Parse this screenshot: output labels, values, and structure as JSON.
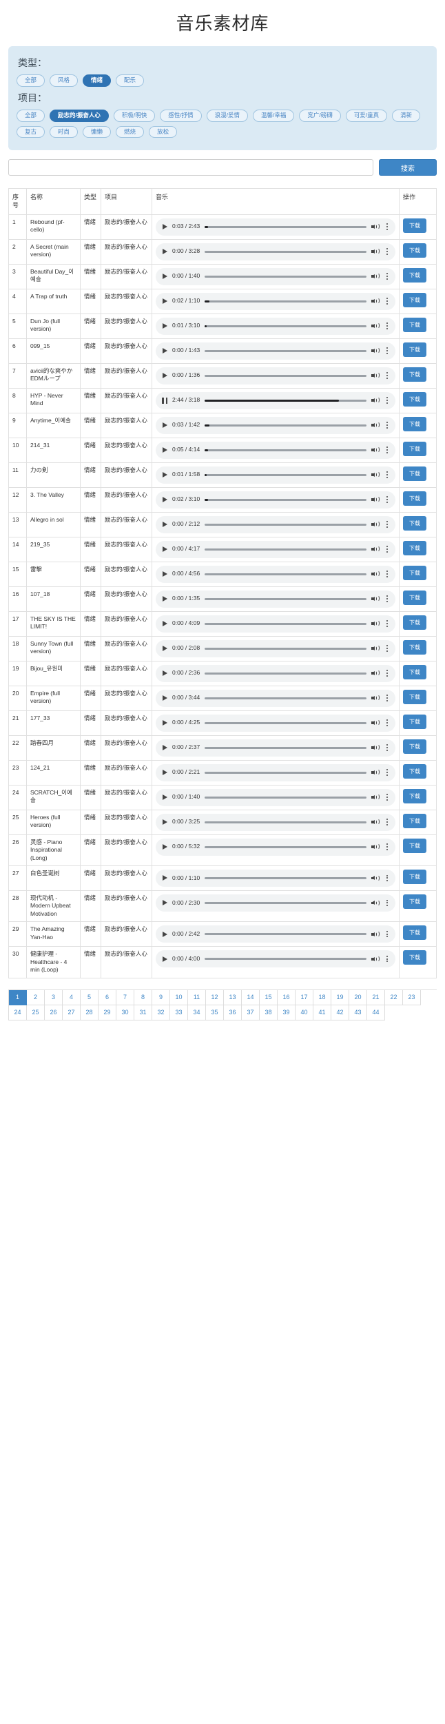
{
  "header": {
    "title": "音乐素材库"
  },
  "filters": {
    "type": {
      "label": "类型：",
      "options": [
        "全部",
        "风格",
        "情绪",
        "配乐"
      ],
      "selected": "情绪"
    },
    "project": {
      "label": "项目：",
      "options": [
        "全部",
        "励志的/振奋人心",
        "积极/明快",
        "感性/抒情",
        "浪漫/爱情",
        "温馨/幸福",
        "宽广/磅礴",
        "可爱/童真",
        "清新",
        "复古",
        "时尚",
        "慵懒",
        "燃烧",
        "放松"
      ],
      "selected": "励志的/振奋人心"
    }
  },
  "search": {
    "value": "",
    "placeholder": "",
    "button_label": "搜索"
  },
  "table": {
    "columns": [
      "序号",
      "名称",
      "类型",
      "项目",
      "音乐",
      "操作"
    ],
    "download_label": "下载",
    "rows": [
      {
        "index": "1",
        "name": "Rebound (pf-cello)",
        "type": "情绪",
        "project": "励志的/振奋人心",
        "time": "0:03 / 2:43",
        "progress": 2,
        "playing": false
      },
      {
        "index": "2",
        "name": "A Secret (main version)",
        "type": "情绪",
        "project": "励志的/振奋人心",
        "time": "0:00 / 3:28",
        "progress": 0,
        "playing": false
      },
      {
        "index": "3",
        "name": "Beautiful Day_이예슬",
        "type": "情绪",
        "project": "励志的/振奋人心",
        "time": "0:00 / 1:40",
        "progress": 0,
        "playing": false
      },
      {
        "index": "4",
        "name": "A Trap of truth",
        "type": "情绪",
        "project": "励志的/振奋人心",
        "time": "0:02 / 1:10",
        "progress": 3,
        "playing": false
      },
      {
        "index": "5",
        "name": "Dun Jo (full version)",
        "type": "情绪",
        "project": "励志的/振奋人心",
        "time": "0:01 / 3:10",
        "progress": 1,
        "playing": false
      },
      {
        "index": "6",
        "name": "099_15",
        "type": "情绪",
        "project": "励志的/振奋人心",
        "time": "0:00 / 1:43",
        "progress": 0,
        "playing": false
      },
      {
        "index": "7",
        "name": "avicii的な爽やかEDMループ",
        "type": "情绪",
        "project": "励志的/振奋人心",
        "time": "0:00 / 1:36",
        "progress": 0,
        "playing": false
      },
      {
        "index": "8",
        "name": "HYP - Never Mind",
        "type": "情绪",
        "project": "励志的/振奋人心",
        "time": "2:44 / 3:18",
        "progress": 83,
        "playing": true
      },
      {
        "index": "9",
        "name": "Anytime_이예솔",
        "type": "情绪",
        "project": "励志的/振奋人心",
        "time": "0:03 / 1:42",
        "progress": 3,
        "playing": false
      },
      {
        "index": "10",
        "name": "214_31",
        "type": "情绪",
        "project": "励志的/振奋人心",
        "time": "0:05 / 4:14",
        "progress": 2,
        "playing": false
      },
      {
        "index": "11",
        "name": "力の剣",
        "type": "情绪",
        "project": "励志的/振奋人心",
        "time": "0:01 / 1:58",
        "progress": 1,
        "playing": false
      },
      {
        "index": "12",
        "name": "3. The Valley",
        "type": "情绪",
        "project": "励志的/振奋人心",
        "time": "0:02 / 3:10",
        "progress": 2,
        "playing": false
      },
      {
        "index": "13",
        "name": "Allegro in sol",
        "type": "情绪",
        "project": "励志的/振奋人心",
        "time": "0:00 / 2:12",
        "progress": 0,
        "playing": false
      },
      {
        "index": "14",
        "name": "219_35",
        "type": "情绪",
        "project": "励志的/振奋人心",
        "time": "0:00 / 4:17",
        "progress": 0,
        "playing": false
      },
      {
        "index": "15",
        "name": "雷擊",
        "type": "情绪",
        "project": "励志的/振奋人心",
        "time": "0:00 / 4:56",
        "progress": 0,
        "playing": false
      },
      {
        "index": "16",
        "name": "107_18",
        "type": "情绪",
        "project": "励志的/振奋人心",
        "time": "0:00 / 1:35",
        "progress": 0,
        "playing": false
      },
      {
        "index": "17",
        "name": "THE SKY IS THE LIMIT!",
        "type": "情绪",
        "project": "励志的/振奋人心",
        "time": "0:00 / 4:09",
        "progress": 0,
        "playing": false
      },
      {
        "index": "18",
        "name": "Sunny Town (full version)",
        "type": "情绪",
        "project": "励志的/振奋人心",
        "time": "0:00 / 2:08",
        "progress": 0,
        "playing": false
      },
      {
        "index": "19",
        "name": "Bijou_유원미",
        "type": "情绪",
        "project": "励志的/振奋人心",
        "time": "0:00 / 2:36",
        "progress": 0,
        "playing": false
      },
      {
        "index": "20",
        "name": "Empire (full version)",
        "type": "情绪",
        "project": "励志的/振奋人心",
        "time": "0:00 / 3:44",
        "progress": 0,
        "playing": false
      },
      {
        "index": "21",
        "name": "177_33",
        "type": "情绪",
        "project": "励志的/振奋人心",
        "time": "0:00 / 4:25",
        "progress": 0,
        "playing": false
      },
      {
        "index": "22",
        "name": "踏春四月",
        "type": "情绪",
        "project": "励志的/振奋人心",
        "time": "0:00 / 2:37",
        "progress": 0,
        "playing": false
      },
      {
        "index": "23",
        "name": "124_21",
        "type": "情绪",
        "project": "励志的/振奋人心",
        "time": "0:00 / 2:21",
        "progress": 0,
        "playing": false
      },
      {
        "index": "24",
        "name": "SCRATCH_이예슬",
        "type": "情绪",
        "project": "励志的/振奋人心",
        "time": "0:00 / 1:40",
        "progress": 0,
        "playing": false
      },
      {
        "index": "25",
        "name": "Heroes (full version)",
        "type": "情绪",
        "project": "励志的/振奋人心",
        "time": "0:00 / 3:25",
        "progress": 0,
        "playing": false
      },
      {
        "index": "26",
        "name": "灵感 - Piano Inspirational (Long)",
        "type": "情绪",
        "project": "励志的/振奋人心",
        "time": "0:00 / 5:32",
        "progress": 0,
        "playing": false
      },
      {
        "index": "27",
        "name": "白色圣诞树",
        "type": "情绪",
        "project": "励志的/振奋人心",
        "time": "0:00 / 1:10",
        "progress": 0,
        "playing": false
      },
      {
        "index": "28",
        "name": "现代动机 - Modern Upbeat Motivation",
        "type": "情绪",
        "project": "励志的/振奋人心",
        "time": "0:00 / 2:30",
        "progress": 0,
        "playing": false
      },
      {
        "index": "29",
        "name": "The Amazing Yan-Hao",
        "type": "情绪",
        "project": "励志的/振奋人心",
        "time": "0:00 / 2:42",
        "progress": 0,
        "playing": false
      },
      {
        "index": "30",
        "name": "健康护理 - Healthcare - 4 min (Loop)",
        "type": "情绪",
        "project": "励志的/振奋人心",
        "time": "0:00 / 4:00",
        "progress": 0,
        "playing": false
      }
    ]
  },
  "pagination": {
    "current": "1",
    "pages": [
      "1",
      "2",
      "3",
      "4",
      "5",
      "6",
      "7",
      "8",
      "9",
      "10",
      "11",
      "12",
      "13",
      "14",
      "15",
      "16",
      "17",
      "18",
      "19",
      "20",
      "21",
      "22",
      "23",
      "24",
      "25",
      "26",
      "27",
      "28",
      "29",
      "30",
      "31",
      "32",
      "33",
      "34",
      "35",
      "36",
      "37",
      "38",
      "39",
      "40",
      "41",
      "42",
      "43",
      "44"
    ]
  },
  "colors": {
    "accent": "#3e86c6",
    "panel": "#dbeaf4",
    "tag_active": "#2f73b3"
  }
}
